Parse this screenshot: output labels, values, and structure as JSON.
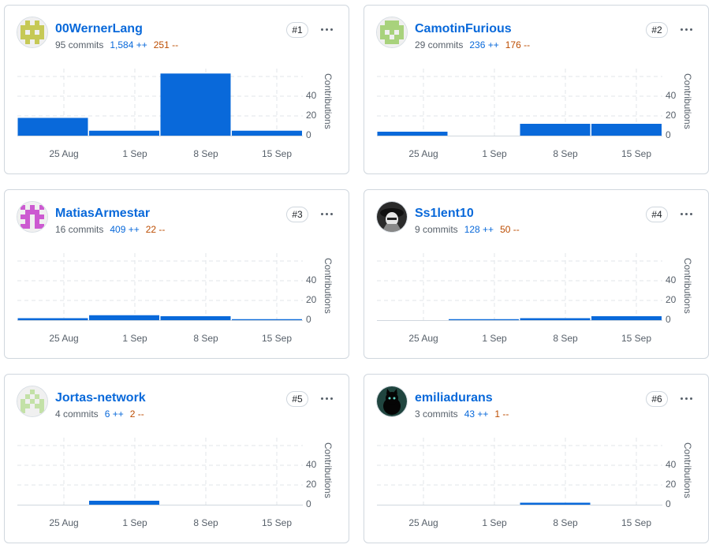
{
  "colors": {
    "bar": "#0969da",
    "link": "#0969da",
    "additions": "#0969da",
    "deletions": "#bc4c00"
  },
  "chart_data": {
    "type": "bar",
    "x_tick_labels": [
      "25 Aug",
      "1 Sep",
      "8 Sep",
      "15 Sep"
    ],
    "y_tick_labels": [
      "0",
      "20",
      "40"
    ],
    "ylabel": "Contributions",
    "ylim": [
      0,
      60
    ],
    "grid": true
  },
  "contributors": [
    {
      "name": "00WernerLang",
      "commits": "95 commits",
      "additions": "1,584 ++",
      "deletions": "251 --",
      "rank": "#1",
      "avatar": "identicon-olive",
      "avatar_color": "#c6c956",
      "values": [
        18,
        5,
        63,
        5
      ]
    },
    {
      "name": "CamotinFurious",
      "commits": "29 commits",
      "additions": "236 ++",
      "deletions": "176 --",
      "rank": "#2",
      "avatar": "identicon-green",
      "avatar_color": "#a8d27c",
      "values": [
        4,
        0,
        12,
        12
      ]
    },
    {
      "name": "MatiasArmestar",
      "commits": "16 commits",
      "additions": "409 ++",
      "deletions": "22 --",
      "rank": "#3",
      "avatar": "identicon-magenta",
      "avatar_color": "#cc5ad1",
      "values": [
        2,
        5,
        4,
        1
      ]
    },
    {
      "name": "Ss1lent10",
      "commits": "9 commits",
      "additions": "128 ++",
      "deletions": "50 --",
      "rank": "#4",
      "avatar": "photo-masked-figure",
      "avatar_color": "#555555",
      "values": [
        0,
        1,
        2,
        4
      ]
    },
    {
      "name": "Jortas-network",
      "commits": "4 commits",
      "additions": "6 ++",
      "deletions": "2 --",
      "rank": "#5",
      "avatar": "identicon-light-green",
      "avatar_color": "#c3e1a7",
      "values": [
        0,
        4,
        0,
        0
      ]
    },
    {
      "name": "emiliadurans",
      "commits": "3 commits",
      "additions": "43 ++",
      "deletions": "1 --",
      "rank": "#6",
      "avatar": "photo-black-cat",
      "avatar_color": "#1a3a3a",
      "values": [
        0,
        0,
        2,
        0
      ]
    }
  ]
}
